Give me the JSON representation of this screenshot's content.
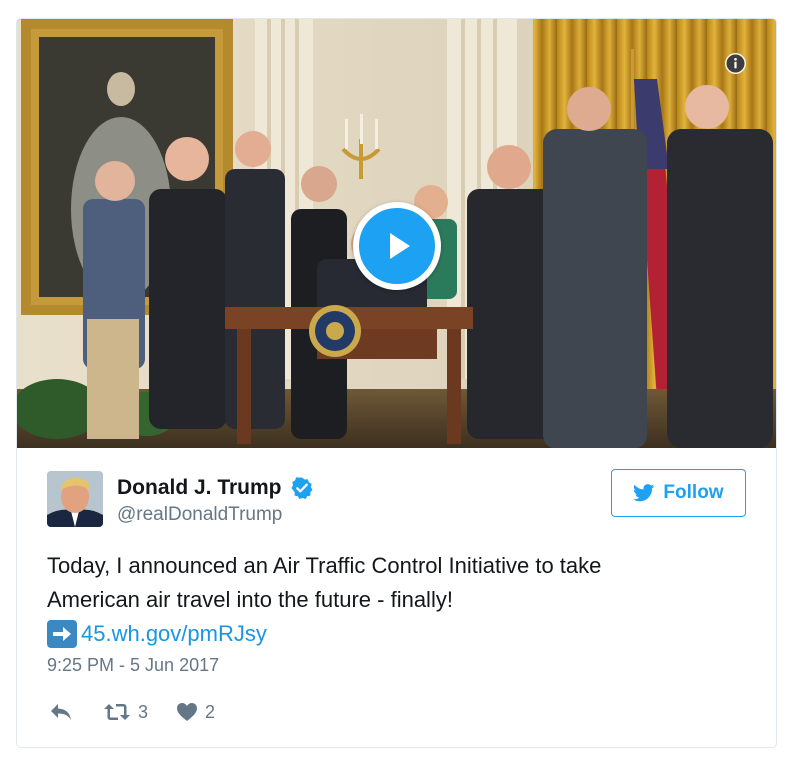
{
  "media": {
    "image_description_icon": "info-icon",
    "play_icon": "play-icon"
  },
  "author": {
    "name": "Donald J. Trump",
    "handle": "@realDonaldTrump",
    "verified_icon": "verified-badge-icon"
  },
  "follow": {
    "label": "Follow",
    "icon": "twitter-bird-icon"
  },
  "tweet": {
    "line1": "Today, I announced an Air Traffic Control Initiative to take",
    "line2": "American air travel into the future - finally!",
    "link_text": "45.wh.gov/pmRJsy",
    "link_emoji": "right-arrow-emoji-icon"
  },
  "timestamp": "9:25 PM - 5 Jun 2017",
  "actions": {
    "reply_icon": "reply-icon",
    "retweet_icon": "retweet-icon",
    "retweet_count": "3",
    "like_icon": "heart-icon",
    "like_count": "2"
  },
  "colors": {
    "brand_blue": "#1da1f2",
    "link_blue": "#1b95e0",
    "secondary_text": "#657786",
    "border": "#e1e8ed"
  }
}
